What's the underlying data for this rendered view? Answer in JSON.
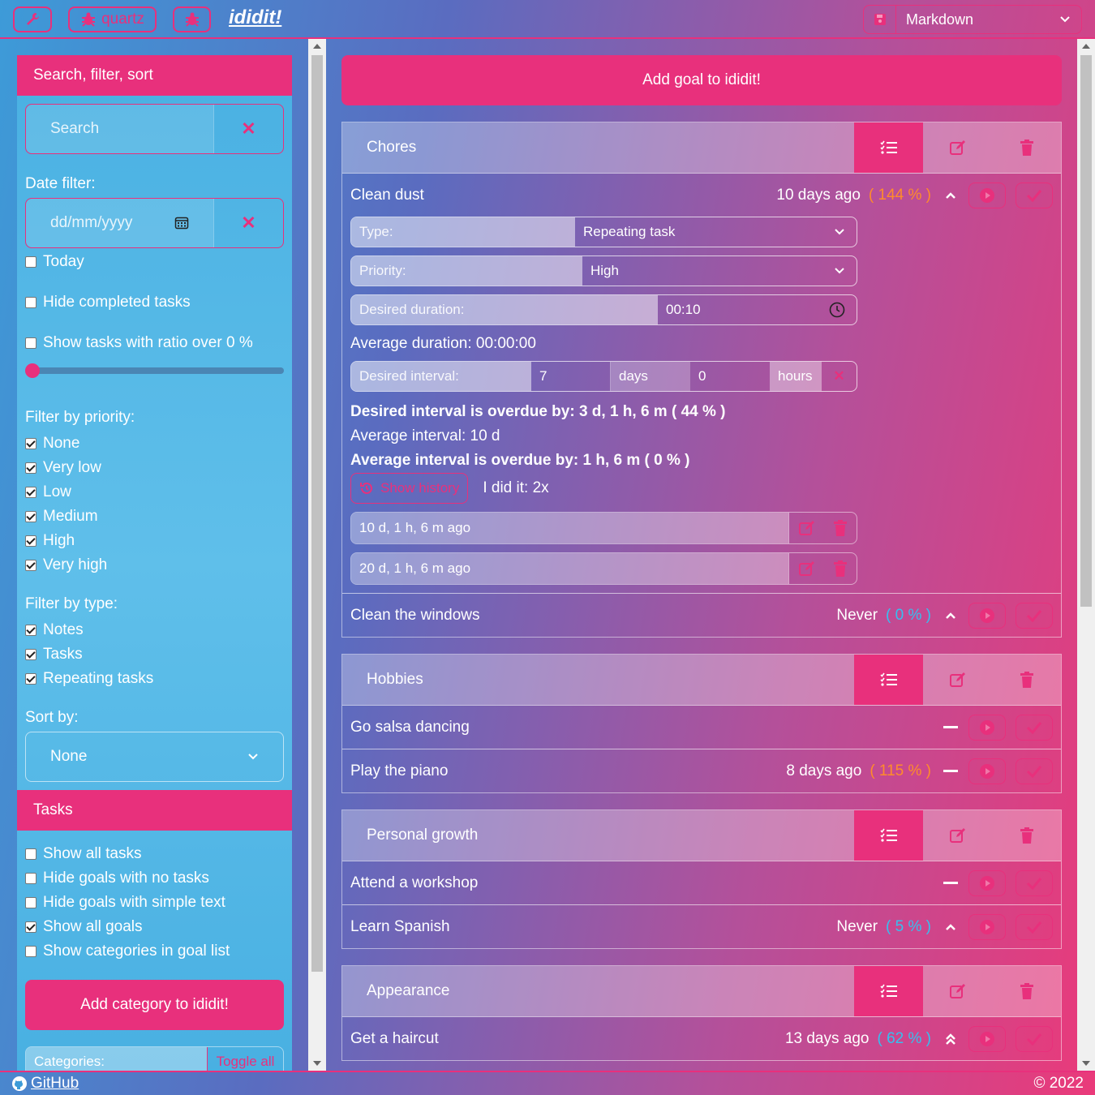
{
  "colors": {
    "accent": "#e8307c",
    "orange": "#ff8c2a",
    "blue": "#35c0f0"
  },
  "topbar": {
    "tool_icon": "wrench-icon",
    "quartz_label": "quartz",
    "logo": "ididit!",
    "format_value": "Markdown"
  },
  "sidebar": {
    "header": "Search, filter, sort",
    "search_placeholder": "Search",
    "date_filter_label": "Date filter:",
    "date_placeholder": "dd/mm/yyyy",
    "today": "Today",
    "hide_completed": "Hide completed tasks",
    "show_ratio": "Show tasks with ratio over 0 %",
    "ratio_value_percent": 0,
    "priority_label": "Filter by priority:",
    "priorities": [
      {
        "label": "None",
        "checked": true
      },
      {
        "label": "Very low",
        "checked": true
      },
      {
        "label": "Low",
        "checked": true
      },
      {
        "label": "Medium",
        "checked": true
      },
      {
        "label": "High",
        "checked": true
      },
      {
        "label": "Very high",
        "checked": true
      }
    ],
    "type_label": "Filter by type:",
    "types": [
      {
        "label": "Notes",
        "checked": true
      },
      {
        "label": "Tasks",
        "checked": true
      },
      {
        "label": "Repeating tasks",
        "checked": true
      }
    ],
    "sort_label": "Sort by:",
    "sort_value": "None",
    "tasks_header": "Tasks",
    "task_options": [
      {
        "label": "Show all tasks",
        "checked": false
      },
      {
        "label": "Hide goals with no tasks",
        "checked": false
      },
      {
        "label": "Hide goals with simple text",
        "checked": false
      },
      {
        "label": "Show all goals",
        "checked": true
      },
      {
        "label": "Show categories in goal list",
        "checked": false
      }
    ],
    "add_category": "Add category to ididit!",
    "categories_label": "Categories:",
    "toggle_all": "Toggle all"
  },
  "main": {
    "add_goal": "Add goal to ididit!",
    "categories": [
      {
        "name": "Chores",
        "goals": [
          {
            "name": "Clean dust",
            "when": "10 days ago",
            "pct": "( 144 % )",
            "pct_color": "orange",
            "icon": "chevron-up-icon",
            "expanded": true
          },
          {
            "name": "Clean the windows",
            "when": "Never",
            "pct": "( 0 % )",
            "pct_color": "blue",
            "icon": "chevron-up-icon"
          }
        ]
      },
      {
        "name": "Hobbies",
        "goals": [
          {
            "name": "Go salsa dancing",
            "when": "",
            "pct": "",
            "pct_color": "",
            "icon": "minus-icon"
          },
          {
            "name": "Play the piano",
            "when": "8 days ago",
            "pct": "( 115 % )",
            "pct_color": "orange",
            "icon": "minus-icon"
          }
        ]
      },
      {
        "name": "Personal growth",
        "goals": [
          {
            "name": "Attend a workshop",
            "when": "",
            "pct": "",
            "pct_color": "",
            "icon": "minus-icon"
          },
          {
            "name": "Learn Spanish",
            "when": "Never",
            "pct": "( 5 % )",
            "pct_color": "blue",
            "icon": "chevron-up-icon"
          }
        ]
      },
      {
        "name": "Appearance",
        "goals": [
          {
            "name": "Get a haircut",
            "when": "13 days ago",
            "pct": "( 62 % )",
            "pct_color": "blue",
            "icon": "double-chevron-up-icon"
          }
        ]
      }
    ],
    "detail": {
      "type_label": "Type:",
      "type_value": "Repeating task",
      "priority_label": "Priority:",
      "priority_value": "High",
      "duration_label": "Desired duration:",
      "duration_value": "00:10",
      "avg_duration": "Average duration: 00:00:00",
      "interval_label": "Desired interval:",
      "interval_days": "7",
      "days_unit": "days",
      "interval_hours": "0",
      "hours_unit": "hours",
      "overdue": "Desired interval is overdue by: 3 d, 1 h, 6 m ( 44 % )",
      "avg_interval": "Average interval: 10 d",
      "avg_overdue": "Average interval is overdue by: 1 h, 6 m ( 0 % )",
      "show_history": "Show history",
      "did_it": "I did it: 2x",
      "history": [
        "10 d, 1 h, 6 m ago",
        "20 d, 1 h, 6 m ago"
      ]
    }
  },
  "footer": {
    "github": "GitHub",
    "copyright": "© 2022"
  }
}
